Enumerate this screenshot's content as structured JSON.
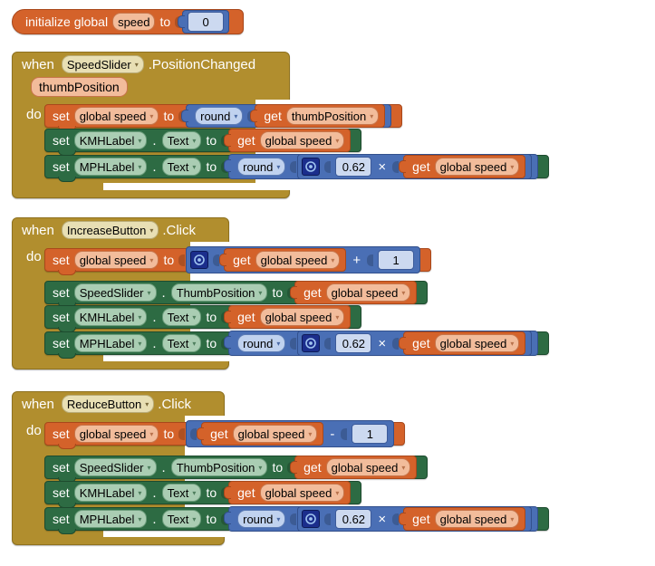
{
  "editor": {
    "name": "MIT App Inventor Blocks Editor",
    "background_color": "#ffffff"
  },
  "palette": {
    "variable_color": "#d4622a",
    "event_color": "#b18e2e",
    "component_color": "#2d6b43",
    "math_color": "#4a6fb5",
    "mutator_color": "#1b2e8c"
  },
  "keywords": {
    "initialize_global": "initialize global",
    "to": "to",
    "when": "when",
    "do": "do",
    "set": "set",
    "get": "get",
    "dot": ".",
    "plus": "+",
    "minus": "-",
    "times": "×",
    "caret": "▾",
    "gear_icon": "gear-icon"
  },
  "blocks": [
    {
      "id": "init-global-speed",
      "type": "variable-declaration",
      "label": "initialize global",
      "variable": "speed",
      "to": "to",
      "value": "0"
    },
    {
      "id": "when-speedslider-positionchanged",
      "type": "event-handler",
      "when": "when",
      "component": "SpeedSlider",
      "event": ".PositionChanged",
      "parameters": [
        "thumbPosition"
      ],
      "do": "do",
      "statements": [
        {
          "kind": "set-variable",
          "set": "set",
          "variable": "global speed",
          "to": "to",
          "value": {
            "kind": "math-round",
            "op": "round",
            "arg": {
              "kind": "get",
              "get": "get",
              "variable": "thumbPosition"
            }
          }
        },
        {
          "kind": "set-property",
          "set": "set",
          "component": "KMHLabel",
          "property": "Text",
          "to": "to",
          "value": {
            "kind": "get",
            "get": "get",
            "variable": "global speed"
          }
        },
        {
          "kind": "set-property",
          "set": "set",
          "component": "MPHLabel",
          "property": "Text",
          "to": "to",
          "value": {
            "kind": "math-round",
            "op": "round",
            "arg": {
              "kind": "multiply",
              "gear": true,
              "left": "0.62",
              "operator": "×",
              "right": {
                "kind": "get",
                "get": "get",
                "variable": "global speed"
              }
            }
          }
        }
      ]
    },
    {
      "id": "when-increasebutton-click",
      "type": "event-handler",
      "when": "when",
      "component": "IncreaseButton",
      "event": ".Click",
      "parameters": [],
      "do": "do",
      "statements": [
        {
          "kind": "set-variable",
          "set": "set",
          "variable": "global speed",
          "to": "to",
          "value": {
            "kind": "add",
            "gear": true,
            "left": {
              "kind": "get",
              "get": "get",
              "variable": "global speed"
            },
            "operator": "+",
            "right": "1"
          }
        },
        {
          "kind": "set-property",
          "set": "set",
          "component": "SpeedSlider",
          "property": "ThumbPosition",
          "to": "to",
          "value": {
            "kind": "get",
            "get": "get",
            "variable": "global speed"
          }
        },
        {
          "kind": "set-property",
          "set": "set",
          "component": "KMHLabel",
          "property": "Text",
          "to": "to",
          "value": {
            "kind": "get",
            "get": "get",
            "variable": "global speed"
          }
        },
        {
          "kind": "set-property",
          "set": "set",
          "component": "MPHLabel",
          "property": "Text",
          "to": "to",
          "value": {
            "kind": "math-round",
            "op": "round",
            "arg": {
              "kind": "multiply",
              "gear": true,
              "left": "0.62",
              "operator": "×",
              "right": {
                "kind": "get",
                "get": "get",
                "variable": "global speed"
              }
            }
          }
        }
      ]
    },
    {
      "id": "when-reducebutton-click",
      "type": "event-handler",
      "when": "when",
      "component": "ReduceButton",
      "event": ".Click",
      "parameters": [],
      "do": "do",
      "statements": [
        {
          "kind": "set-variable",
          "set": "set",
          "variable": "global speed",
          "to": "to",
          "value": {
            "kind": "subtract",
            "gear": false,
            "left": {
              "kind": "get",
              "get": "get",
              "variable": "global speed"
            },
            "operator": "-",
            "right": "1"
          }
        },
        {
          "kind": "set-property",
          "set": "set",
          "component": "SpeedSlider",
          "property": "ThumbPosition",
          "to": "to",
          "value": {
            "kind": "get",
            "get": "get",
            "variable": "global speed"
          }
        },
        {
          "kind": "set-property",
          "set": "set",
          "component": "KMHLabel",
          "property": "Text",
          "to": "to",
          "value": {
            "kind": "get",
            "get": "get",
            "variable": "global speed"
          }
        },
        {
          "kind": "set-property",
          "set": "set",
          "component": "MPHLabel",
          "property": "Text",
          "to": "to",
          "value": {
            "kind": "math-round",
            "op": "round",
            "arg": {
              "kind": "multiply",
              "gear": true,
              "left": "0.62",
              "operator": "×",
              "right": {
                "kind": "get",
                "get": "get",
                "variable": "global speed"
              }
            }
          }
        }
      ]
    }
  ]
}
